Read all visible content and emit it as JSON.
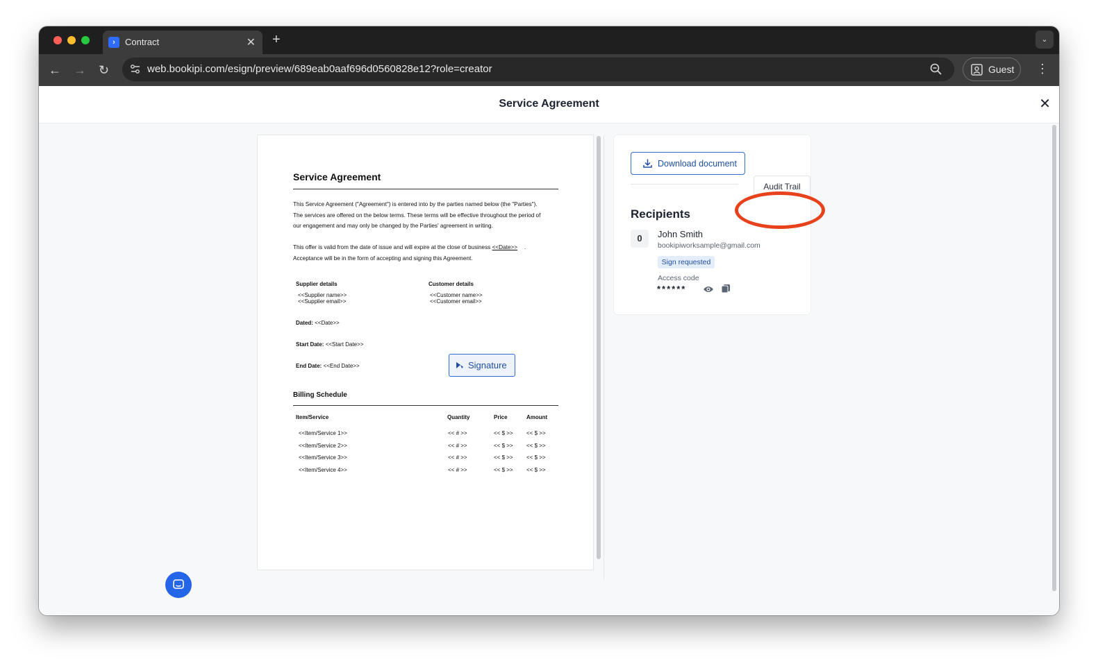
{
  "browser": {
    "tab_title": "Contract",
    "url": "web.bookipi.com/esign/preview/689eab0aaf696d0560828e12?role=creator",
    "profile_label": "Guest"
  },
  "page": {
    "title": "Service Agreement"
  },
  "document": {
    "heading": "Service Agreement",
    "intro_lines": [
      "This Service Agreement (\"Agreement\") is entered into by the parties named below (the \"Parties\").",
      "The services are offered on the below terms. These terms will be effective throughout the period of",
      "our engagement and may only be changed by the Parties' agreement in writing."
    ],
    "offer_line_1": "This offer is valid from the date of issue and will expire at the close of business ",
    "offer_date": "<<Date>>",
    "offer_line_2": "Acceptance will be in the form of accepting and signing this Agreement.",
    "supplier_heading": "Supplier details",
    "supplier_name": "<<Supplier name>>",
    "supplier_email": "<<Supplier email>>",
    "customer_heading": "Customer details",
    "customer_name": "<<Customer name>>",
    "customer_email": "<<Customer email>>",
    "dated_label": "Dated:",
    "dated_value": "<<Date>>",
    "start_label": "Start Date:",
    "start_value": "<<Start Date>>",
    "end_label": "End Date:",
    "end_value": "<<End Date>>",
    "signature_label": "Signature",
    "billing_heading": "Billing Schedule",
    "billing_columns": [
      "Item/Service",
      "Quantity",
      "Price",
      "Amount"
    ],
    "billing_rows": [
      [
        "<<Item/Service 1>>",
        "<< # >>",
        "<< $ >>",
        "<< $ >>"
      ],
      [
        "<<Item/Service 2>>",
        "<< # >>",
        "<< $ >>",
        "<< $ >>"
      ],
      [
        "<<Item/Service 3>>",
        "<< # >>",
        "<< $ >>",
        "<< $ >>"
      ],
      [
        "<<Item/Service 4>>",
        "<< # >>",
        "<< $ >>",
        "<< $ >>"
      ]
    ]
  },
  "sidebar": {
    "download_label": "Download document",
    "audit_tab_label": "Audit Trail",
    "recipients_heading": "Recipients",
    "recipient": {
      "order": "0",
      "name": "John Smith",
      "email": "bookipiworksample@gmail.com",
      "status": "Sign requested",
      "access_label": "Access code",
      "access_code": "******"
    }
  },
  "colors": {
    "accent": "#2f6bd3",
    "highlight_ring": "#e8421c",
    "chat_button": "#2565e8"
  }
}
